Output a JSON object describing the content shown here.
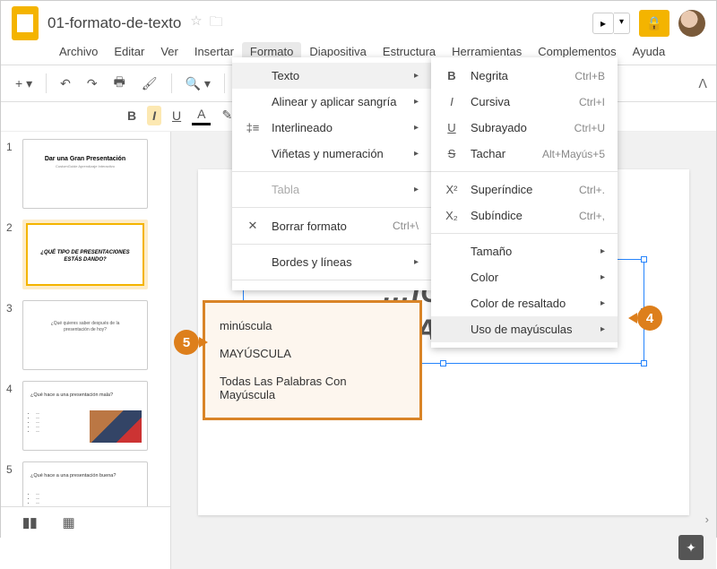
{
  "doc": {
    "title": "01-formato-de-texto"
  },
  "menus": {
    "items": [
      "Archivo",
      "Editar",
      "Ver",
      "Insertar",
      "Formato",
      "Diapositiva",
      "Estructura",
      "Herramientas",
      "Complementos",
      "Ayuda"
    ],
    "active": "Formato"
  },
  "thumbs": {
    "s1": {
      "num": "1",
      "title": "Dar una Gran Presentación",
      "sub": "CustomGuide Aprendizaje Interactivo"
    },
    "s2": {
      "num": "2",
      "q1": "¿QUÉ TIPO DE PRESENTACIONES",
      "q2": "ESTÁS DANDO?"
    },
    "s3": {
      "num": "3",
      "q1": "¿Qué quieres saber después de la",
      "q2": "presentación de hoy?"
    },
    "s4": {
      "num": "4",
      "h": "¿Qué hace a una presentación mala?"
    },
    "s5": {
      "num": "5",
      "h": "¿Qué hace a una presentación buena?"
    }
  },
  "slide": {
    "line1": "…IONES",
    "line2": "…DANDO?"
  },
  "format_menu": {
    "texto": "Texto",
    "alinear": "Alinear y aplicar sangría",
    "interlineado": "Interlineado",
    "vinetas": "Viñetas y numeración",
    "tabla": "Tabla",
    "borrar": "Borrar formato",
    "borrar_sc": "Ctrl+\\",
    "bordes": "Bordes y líneas"
  },
  "text_menu": {
    "negrita": "Negrita",
    "negrita_sc": "Ctrl+B",
    "cursiva": "Cursiva",
    "cursiva_sc": "Ctrl+I",
    "subrayado": "Subrayado",
    "subrayado_sc": "Ctrl+U",
    "tachar": "Tachar",
    "tachar_sc": "Alt+Mayús+5",
    "super": "Superíndice",
    "super_sc": "Ctrl+.",
    "sub": "Subíndice",
    "sub_sc": "Ctrl+,",
    "tamano": "Tamaño",
    "color": "Color",
    "resaltado": "Color de resaltado",
    "mayus": "Uso de mayúsculas"
  },
  "cap_menu": {
    "lower": "minúscula",
    "upper": "MAYÚSCULA",
    "title": "Todas Las Palabras Con Mayúscula"
  },
  "steps": {
    "s4": "4",
    "s5": "5"
  }
}
